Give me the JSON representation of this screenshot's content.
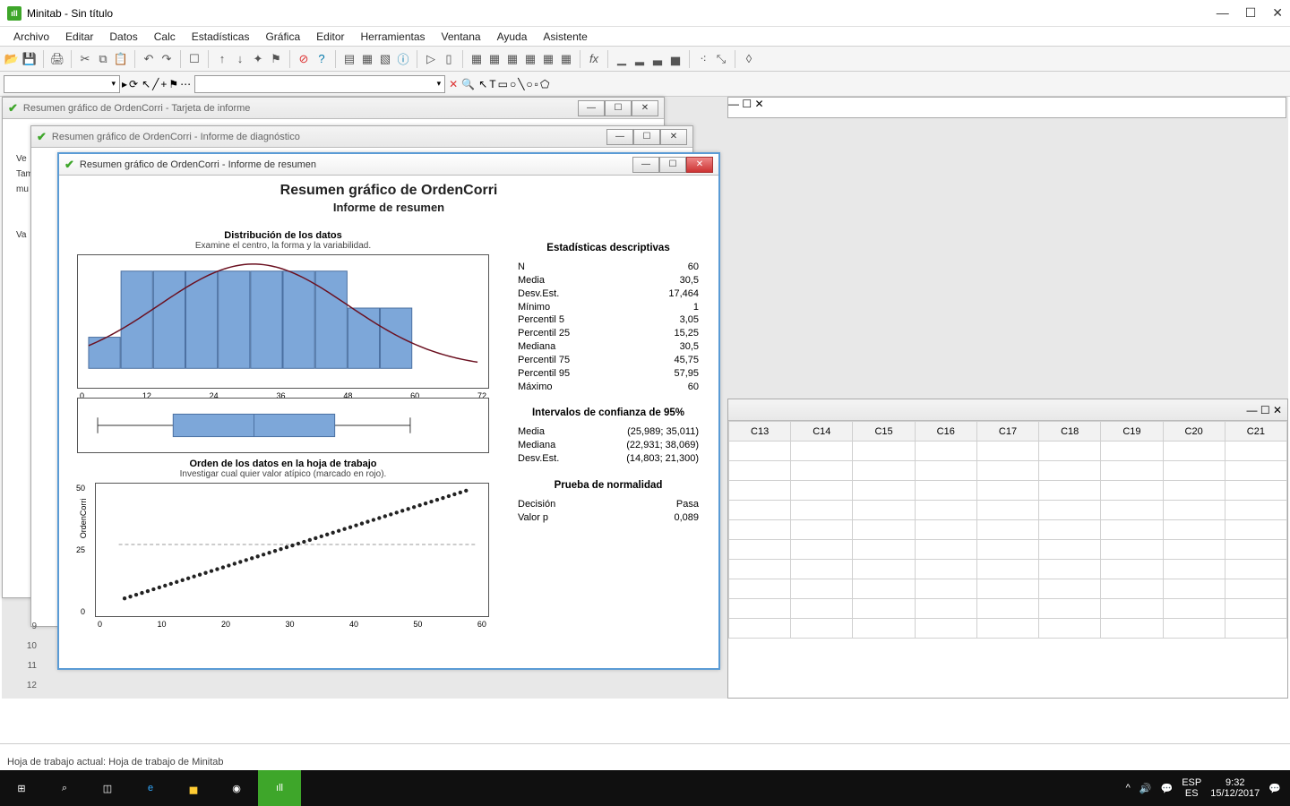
{
  "app": {
    "title": "Minitab - Sin título"
  },
  "menu": [
    "Archivo",
    "Editar",
    "Datos",
    "Calc",
    "Estadísticas",
    "Gráfica",
    "Editor",
    "Herramientas",
    "Ventana",
    "Ayuda",
    "Asistente"
  ],
  "windows": {
    "tarjeta": "Resumen gráfico de OrdenCorri - Tarjeta de informe",
    "diagnostico": "Resumen gráfico de OrdenCorri - Informe de diagnóstico",
    "resumen": "Resumen gráfico de OrdenCorri - Informe de resumen"
  },
  "leftcol": {
    "ve": "Ve",
    "tam": "Tam",
    "mu": "mu",
    "va": "Va"
  },
  "report": {
    "title": "Resumen gráfico de OrdenCorri",
    "subtitle": "Informe de resumen",
    "dist_title": "Distribución de los datos",
    "dist_sub": "Examine el centro, la forma y la variabilidad.",
    "order_title": "Orden de los datos en la hoja de trabajo",
    "order_sub": "Investigar cual quier valor atípico (marcado en rojo).",
    "ylabel": "OrdenCorri"
  },
  "stats": {
    "h1": "Estadísticas descriptivas",
    "rows": [
      [
        "N",
        "60"
      ],
      [
        "Media",
        "30,5"
      ],
      [
        "Desv.Est.",
        "17,464"
      ],
      [
        "Mínimo",
        "1"
      ],
      [
        "Percentil 5",
        "3,05"
      ],
      [
        "Percentil 25",
        "15,25"
      ],
      [
        "Mediana",
        "30,5"
      ],
      [
        "Percentil 75",
        "45,75"
      ],
      [
        "Percentil 95",
        "57,95"
      ],
      [
        "Máximo",
        "60"
      ]
    ],
    "h2": "Intervalos de confianza de 95%",
    "ci": [
      [
        "Media",
        "(25,989; 35,011)"
      ],
      [
        "Mediana",
        "(22,931; 38,069)"
      ],
      [
        "Desv.Est.",
        "(14,803; 21,300)"
      ]
    ],
    "h3": "Prueba de normalidad",
    "norm": [
      [
        "Decisión",
        "Pasa"
      ],
      [
        "Valor p",
        "0,089"
      ]
    ]
  },
  "chart_data": [
    {
      "type": "bar",
      "title": "Distribución de los datos",
      "x_ticks": [
        0,
        12,
        24,
        36,
        48,
        60,
        72
      ],
      "bins": [
        {
          "lo": 0,
          "hi": 6,
          "count": 6,
          "rel": 0.32
        },
        {
          "lo": 6,
          "hi": 12,
          "count": 6,
          "rel": 1.0
        },
        {
          "lo": 12,
          "hi": 18,
          "count": 6,
          "rel": 1.0
        },
        {
          "lo": 18,
          "hi": 24,
          "count": 6,
          "rel": 1.0
        },
        {
          "lo": 24,
          "hi": 30,
          "count": 6,
          "rel": 1.0
        },
        {
          "lo": 30,
          "hi": 36,
          "count": 6,
          "rel": 1.0
        },
        {
          "lo": 36,
          "hi": 42,
          "count": 6,
          "rel": 1.0
        },
        {
          "lo": 42,
          "hi": 48,
          "count": 6,
          "rel": 1.0
        },
        {
          "lo": 48,
          "hi": 54,
          "count": 6,
          "rel": 0.62
        },
        {
          "lo": 54,
          "hi": 60,
          "count": 6,
          "rel": 0.62
        }
      ],
      "normal_curve": {
        "mu": 30.5,
        "sd": 17.464
      },
      "xlim": [
        0,
        72
      ]
    },
    {
      "type": "boxplot",
      "min": 1,
      "q1": 15.25,
      "median": 30.5,
      "q3": 45.75,
      "max": 60,
      "xlim": [
        0,
        72
      ]
    },
    {
      "type": "scatter",
      "title": "Orden de los datos en la hoja de trabajo",
      "x": [
        1,
        2,
        3,
        4,
        5,
        6,
        7,
        8,
        9,
        10,
        11,
        12,
        13,
        14,
        15,
        16,
        17,
        18,
        19,
        20,
        21,
        22,
        23,
        24,
        25,
        26,
        27,
        28,
        29,
        30,
        31,
        32,
        33,
        34,
        35,
        36,
        37,
        38,
        39,
        40,
        41,
        42,
        43,
        44,
        45,
        46,
        47,
        48,
        49,
        50,
        51,
        52,
        53,
        54,
        55,
        56,
        57,
        58,
        59,
        60
      ],
      "y": [
        1,
        2,
        3,
        4,
        5,
        6,
        7,
        8,
        9,
        10,
        11,
        12,
        13,
        14,
        15,
        16,
        17,
        18,
        19,
        20,
        21,
        22,
        23,
        24,
        25,
        26,
        27,
        28,
        29,
        30,
        31,
        32,
        33,
        34,
        35,
        36,
        37,
        38,
        39,
        40,
        41,
        42,
        43,
        44,
        45,
        46,
        47,
        48,
        49,
        50,
        51,
        52,
        53,
        54,
        55,
        56,
        57,
        58,
        59,
        60
      ],
      "ref_line": 30.5,
      "xlim": [
        0,
        62
      ],
      "ylim": [
        0,
        60
      ],
      "x_ticks": [
        0,
        10,
        20,
        30,
        40,
        50,
        60
      ],
      "y_ticks": [
        0,
        25,
        50
      ],
      "ylabel": "OrdenCorri"
    }
  ],
  "worksheet": {
    "cols": [
      "C13",
      "C14",
      "C15",
      "C16",
      "C17",
      "C18",
      "C19",
      "C20",
      "C21"
    ],
    "rows_visible": 10,
    "left_row_nums": [
      "9",
      "10",
      "11",
      "12"
    ]
  },
  "status": "Hoja de trabajo actual: Hoja de trabajo de Minitab",
  "tray": {
    "lang": "ESP",
    "loc": "ES",
    "time": "9:32",
    "date": "15/12/2017"
  }
}
